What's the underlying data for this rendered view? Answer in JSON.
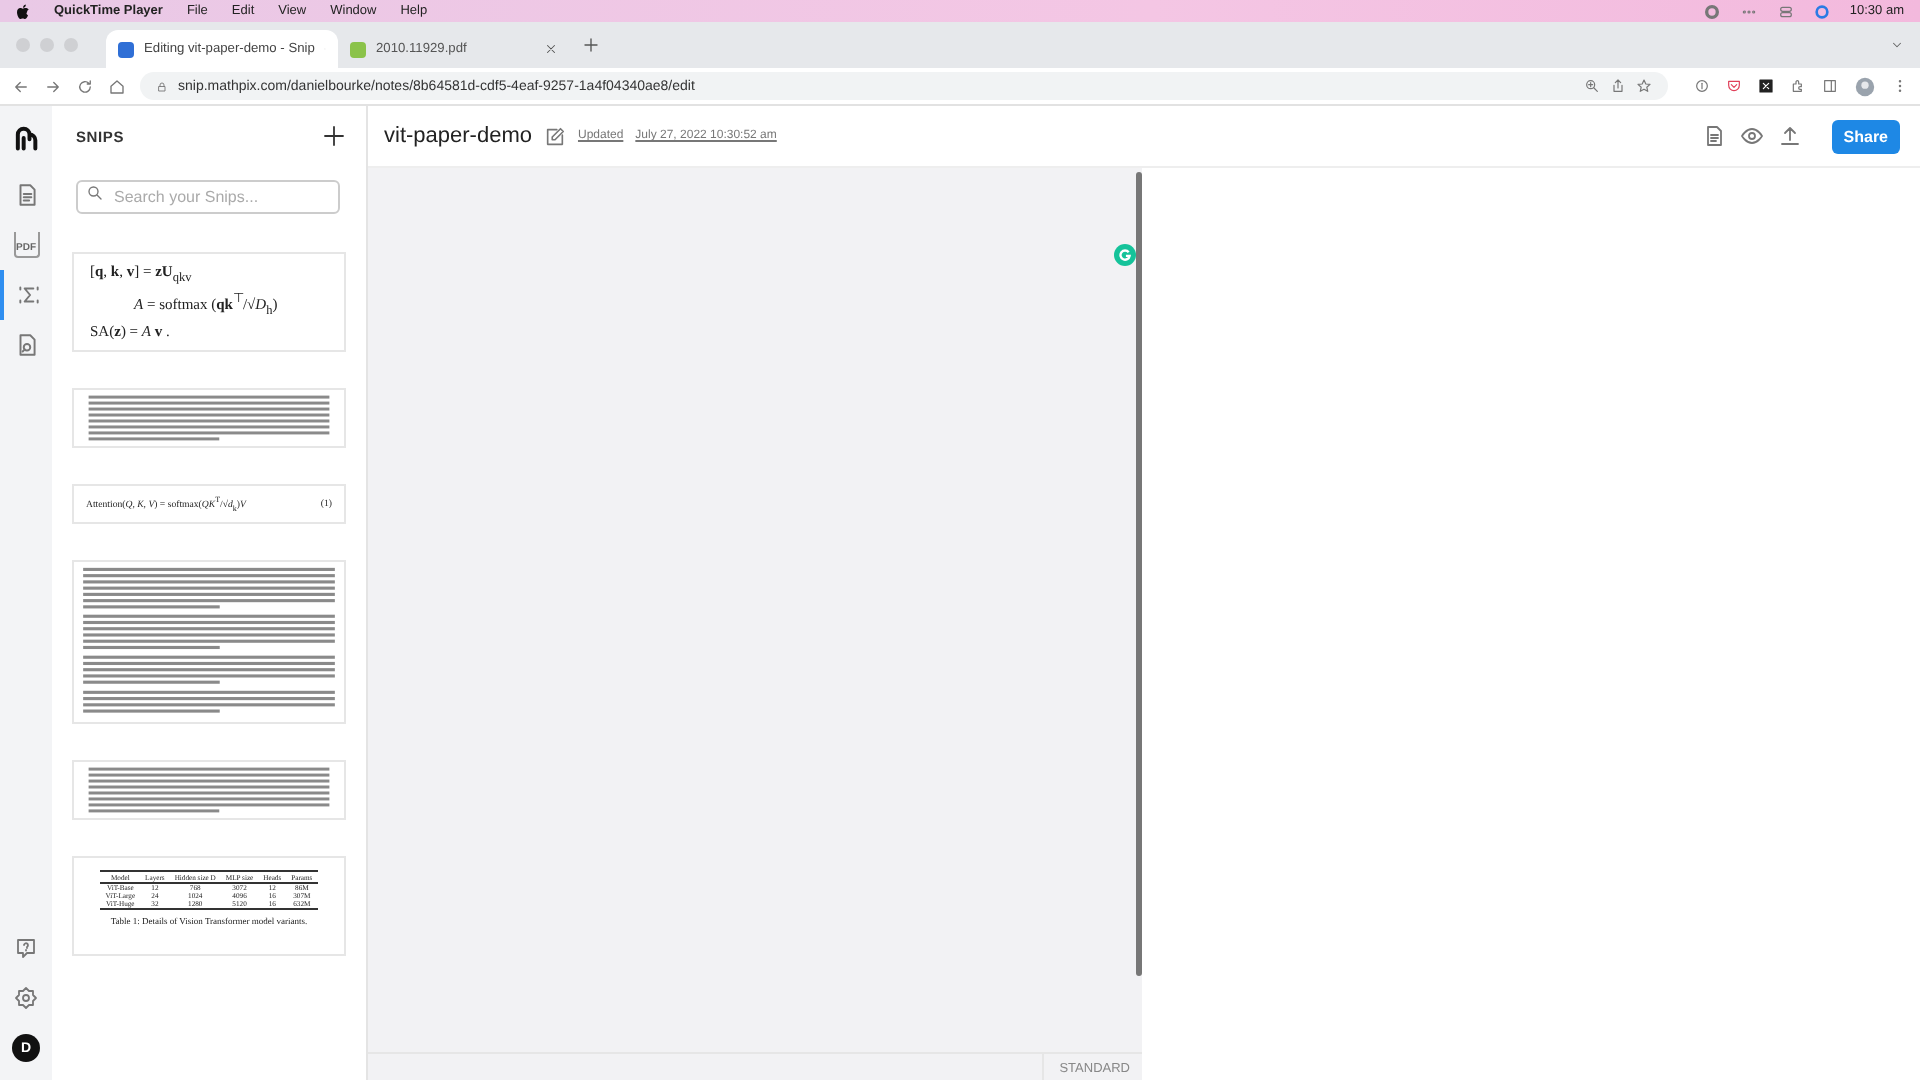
{
  "menubar": {
    "app": "QuickTime Player",
    "menus": [
      "File",
      "Edit",
      "View",
      "Window",
      "Help"
    ],
    "time": "10:30 am"
  },
  "browser": {
    "tabs": [
      {
        "title": "Editing vit-paper-demo - Snip",
        "selected": true,
        "kind": "snip"
      },
      {
        "title": "2010.11929.pdf",
        "selected": false,
        "kind": "pdf"
      }
    ],
    "url": "snip.mathpix.com/danielbourke/notes/8b64581d-cdf5-4eaf-9257-1a4f04340ae8/edit"
  },
  "rail": {
    "items": [
      {
        "kind": "notes",
        "selected": false
      },
      {
        "kind": "pdf",
        "label": "PDF",
        "selected": false
      },
      {
        "kind": "formula",
        "selected": true
      },
      {
        "kind": "search-doc",
        "selected": false
      }
    ],
    "bottom": [
      {
        "kind": "help"
      },
      {
        "kind": "settings"
      }
    ],
    "avatar": "D"
  },
  "snips": {
    "title": "SNIPS",
    "search": {
      "placeholder": "Search your Snips..."
    },
    "items": [
      {
        "kind": "formula",
        "lines": [
          "[**q**, **k**, **v**] = **zU**$_{qkv}$",
          "*A* = softmax (**qk**$^{⊤}$/√*D*$_{h}$)",
          "SA(**z**) = *A* **v** ."
        ]
      },
      {
        "kind": "paragraph"
      },
      {
        "kind": "equation",
        "formula": "Attention(*Q*, *K*, *V*) = softmax(*QK*$^{T}$/√*d*$_{k}$)*V*",
        "number": "(1)"
      },
      {
        "kind": "paragraphs"
      },
      {
        "kind": "paragraph"
      },
      {
        "kind": "table",
        "columns": [
          "Model",
          "Layers",
          "Hidden size D",
          "MLP size",
          "Heads",
          "Params"
        ],
        "rows": [
          [
            "ViT-Base",
            "12",
            "768",
            "3072",
            "12",
            "86M"
          ],
          [
            "ViT-Large",
            "24",
            "1024",
            "4096",
            "16",
            "307M"
          ],
          [
            "ViT-Huge",
            "32",
            "1280",
            "5120",
            "16",
            "632M"
          ]
        ],
        "caption": "Table 1: Details of Vision Transformer model variants."
      }
    ]
  },
  "document": {
    "title": "vit-paper-demo",
    "updated_label": "Updated",
    "updated_time": "July 27, 2022 10:30:52 am",
    "share": "Share"
  },
  "editor": {
    "mode": "STANDARD"
  }
}
